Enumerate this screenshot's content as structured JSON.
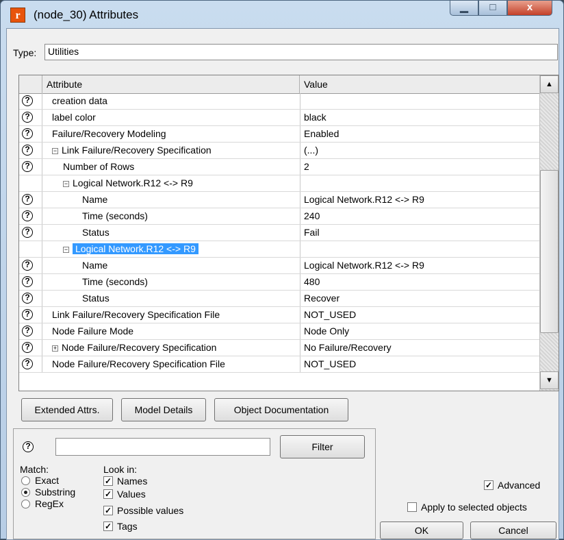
{
  "window": {
    "title": "(node_30) Attributes",
    "controls": {
      "minimize": "▁",
      "maximize": "□",
      "close": "x"
    }
  },
  "type_field": {
    "label": "Type:",
    "value": "Utilities"
  },
  "grid": {
    "headers": {
      "attribute": "Attribute",
      "value": "Value"
    },
    "rows": [
      {
        "attribute": "creation data",
        "value": ""
      },
      {
        "attribute": "label color",
        "value": "black"
      },
      {
        "attribute": "Failure/Recovery Modeling",
        "value": "Enabled"
      },
      {
        "attribute": "Link Failure/Recovery Specification",
        "value": "(...)"
      },
      {
        "attribute": "Number of Rows",
        "value": "2"
      },
      {
        "attribute": "Logical Network.R12 <-> R9",
        "value": ""
      },
      {
        "attribute": "Name",
        "value": "Logical Network.R12 <-> R9"
      },
      {
        "attribute": "Time (seconds)",
        "value": "240"
      },
      {
        "attribute": "Status",
        "value": "Fail"
      },
      {
        "attribute": "Logical Network.R12 <-> R9",
        "value": ""
      },
      {
        "attribute": "Name",
        "value": "Logical Network.R12 <-> R9"
      },
      {
        "attribute": "Time (seconds)",
        "value": "480"
      },
      {
        "attribute": "Status",
        "value": "Recover"
      },
      {
        "attribute": "Link Failure/Recovery Specification File",
        "value": "NOT_USED"
      },
      {
        "attribute": "Node Failure Mode",
        "value": "Node Only"
      },
      {
        "attribute": "Node Failure/Recovery Specification",
        "value": "No Failure/Recovery"
      },
      {
        "attribute": "Node Failure/Recovery Specification File",
        "value": "NOT_USED"
      }
    ],
    "help_glyph": "?",
    "expander_minus": "−",
    "expander_plus": "+"
  },
  "buttons": {
    "extended_attrs": "Extended Attrs.",
    "model_details": "Model Details",
    "object_documentation": "Object Documentation",
    "filter": "Filter",
    "ok": "OK",
    "cancel": "Cancel"
  },
  "filter_panel": {
    "help_glyph": "?",
    "search_value": "",
    "match_label": "Match:",
    "match_options": [
      "Exact",
      "Substring",
      "RegEx"
    ],
    "match_selected": "Substring",
    "lookin_label": "Look in:",
    "lookin_options": [
      "Names",
      "Values",
      "Possible values",
      "Tags"
    ],
    "check_glyph": "✓"
  },
  "options": {
    "advanced": {
      "label": "Advanced",
      "checked": true
    },
    "apply_selected": {
      "label": "Apply to selected objects",
      "checked": false
    }
  },
  "colors": {
    "selection": "#3399ff",
    "close_button": "#c4412a",
    "app_icon": "#e8540c"
  }
}
